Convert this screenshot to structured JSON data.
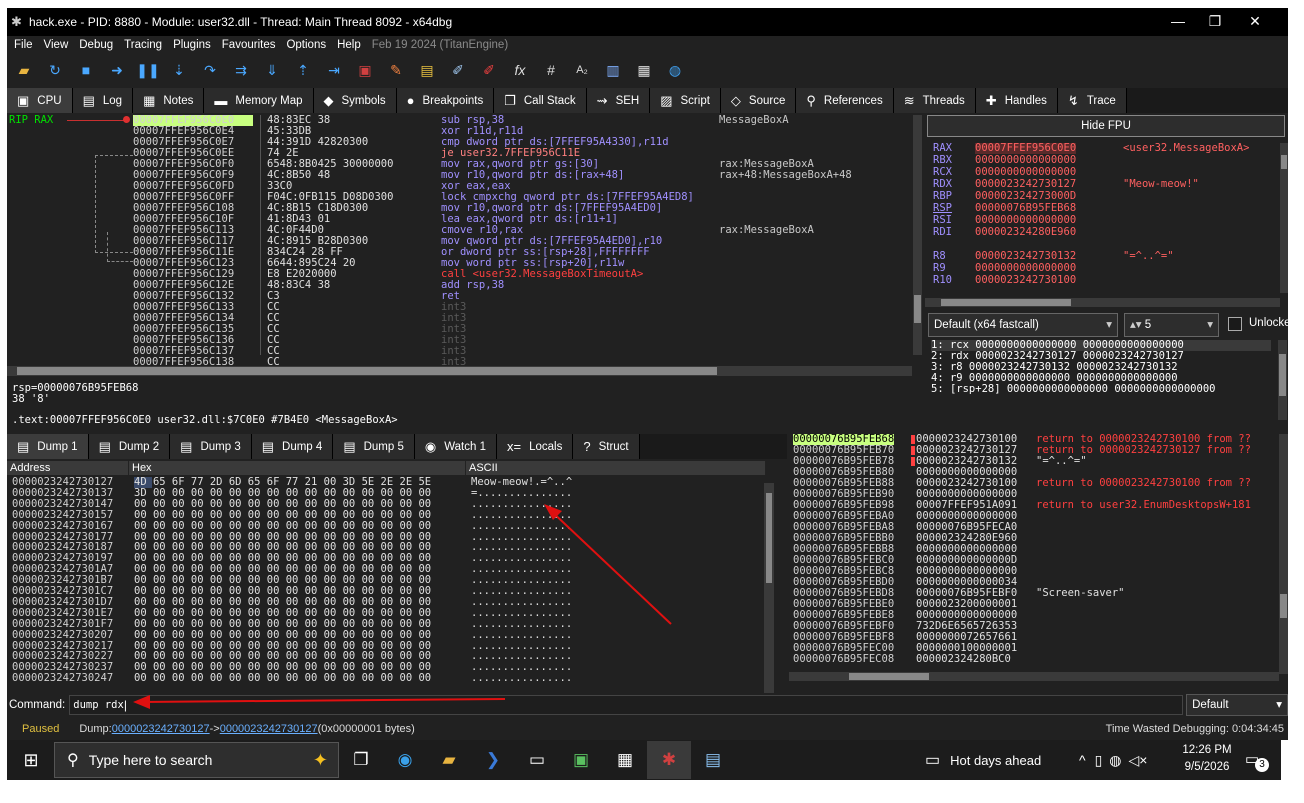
{
  "window": {
    "title": "hack.exe - PID: 8880 - Module: user32.dll - Thread: Main Thread 8092 - x64dbg",
    "minimize": "—",
    "maximize": "❐",
    "close": "✕"
  },
  "menu": {
    "items": [
      "File",
      "View",
      "Debug",
      "Tracing",
      "Plugins",
      "Favourites",
      "Options",
      "Help"
    ],
    "build": "Feb 19 2024 (TitanEngine)"
  },
  "tabs": [
    {
      "label": "CPU",
      "icon": "cpu-icon",
      "glyph": "▣"
    },
    {
      "label": "Log",
      "icon": "log-icon",
      "glyph": "▤"
    },
    {
      "label": "Notes",
      "icon": "notes-icon",
      "glyph": "▦"
    },
    {
      "label": "Memory Map",
      "icon": "memory-map-icon",
      "glyph": "▬"
    },
    {
      "label": "Symbols",
      "icon": "symbols-icon",
      "glyph": "◆"
    },
    {
      "label": "Breakpoints",
      "icon": "breakpoints-icon",
      "glyph": "●"
    },
    {
      "label": "Call Stack",
      "icon": "call-stack-icon",
      "glyph": "❐"
    },
    {
      "label": "SEH",
      "icon": "seh-icon",
      "glyph": "⇝"
    },
    {
      "label": "Script",
      "icon": "script-icon",
      "glyph": "▨"
    },
    {
      "label": "Source",
      "icon": "source-icon",
      "glyph": "◇"
    },
    {
      "label": "References",
      "icon": "references-icon",
      "glyph": "⚲"
    },
    {
      "label": "Threads",
      "icon": "threads-icon",
      "glyph": "≋"
    },
    {
      "label": "Handles",
      "icon": "handles-icon",
      "glyph": "✚"
    },
    {
      "label": "Trace",
      "icon": "trace-icon",
      "glyph": "↯"
    }
  ],
  "disasm": {
    "rip_label": "RIP RAX",
    "rows": [
      {
        "addr": "00007FFEF956C0E0",
        "bytes": "48:83EC 38",
        "asm": "sub rsp,38",
        "cmt": "MessageBoxA"
      },
      {
        "addr": "00007FFEF956C0E4",
        "bytes": "45:33DB",
        "asm": "xor r11d,r11d",
        "cmt": ""
      },
      {
        "addr": "00007FFEF956C0E7",
        "bytes": "44:391D 42820300",
        "asm": "cmp dword ptr ds:[7FFEF95A4330],r11d",
        "cmt": ""
      },
      {
        "addr": "00007FFEF956C0EE",
        "bytes": "74 2E",
        "asm": "je user32.7FFEF956C11E",
        "cmt": ""
      },
      {
        "addr": "00007FFEF956C0F0",
        "bytes": "6548:8B0425 30000000",
        "asm": "mov rax,qword ptr gs:[30]",
        "cmt": "rax:MessageBoxA"
      },
      {
        "addr": "00007FFEF956C0F9",
        "bytes": "4C:8B50 48",
        "asm": "mov r10,qword ptr ds:[rax+48]",
        "cmt": "rax+48:MessageBoxA+48"
      },
      {
        "addr": "00007FFEF956C0FD",
        "bytes": "33C0",
        "asm": "xor eax,eax",
        "cmt": ""
      },
      {
        "addr": "00007FFEF956C0FF",
        "bytes": "F04C:0FB115 D08D0300",
        "asm": "lock cmpxchg qword ptr ds:[7FFEF95A4ED8]",
        "cmt": ""
      },
      {
        "addr": "00007FFEF956C108",
        "bytes": "4C:8B15 C18D0300",
        "asm": "mov r10,qword ptr ds:[7FFEF95A4ED0]",
        "cmt": ""
      },
      {
        "addr": "00007FFEF956C10F",
        "bytes": "41:8D43 01",
        "asm": "lea eax,qword ptr ds:[r11+1]",
        "cmt": ""
      },
      {
        "addr": "00007FFEF956C113",
        "bytes": "4C:0F44D0",
        "asm": "cmove r10,rax",
        "cmt": "rax:MessageBoxA"
      },
      {
        "addr": "00007FFEF956C117",
        "bytes": "4C:8915 B28D0300",
        "asm": "mov qword ptr ds:[7FFEF95A4ED0],r10",
        "cmt": ""
      },
      {
        "addr": "00007FFEF956C11E",
        "bytes": "834C24 28 FF",
        "asm": "or dword ptr ss:[rsp+28],FFFFFFFF",
        "cmt": ""
      },
      {
        "addr": "00007FFEF956C123",
        "bytes": "6644:895C24 20",
        "asm": "mov word ptr ss:[rsp+20],r11w",
        "cmt": ""
      },
      {
        "addr": "00007FFEF956C129",
        "bytes": "E8 E2020000",
        "asm": "call <user32.MessageBoxTimeoutA>",
        "cmt": ""
      },
      {
        "addr": "00007FFEF956C12E",
        "bytes": "48:83C4 38",
        "asm": "add rsp,38",
        "cmt": ""
      },
      {
        "addr": "00007FFEF956C132",
        "bytes": "C3",
        "asm": "ret",
        "cmt": ""
      },
      {
        "addr": "00007FFEF956C133",
        "bytes": "CC",
        "asm": "int3",
        "cmt": ""
      },
      {
        "addr": "00007FFEF956C134",
        "bytes": "CC",
        "asm": "int3",
        "cmt": ""
      },
      {
        "addr": "00007FFEF956C135",
        "bytes": "CC",
        "asm": "int3",
        "cmt": ""
      },
      {
        "addr": "00007FFEF956C136",
        "bytes": "CC",
        "asm": "int3",
        "cmt": ""
      },
      {
        "addr": "00007FFEF956C137",
        "bytes": "CC",
        "asm": "int3",
        "cmt": ""
      },
      {
        "addr": "00007FFEF956C138",
        "bytes": "CC",
        "asm": "int3",
        "cmt": ""
      }
    ]
  },
  "info": {
    "line1": "rsp=00000076B95FEB68",
    "line2": "38 '8'",
    "line3": ".text:00007FFEF956C0E0 user32.dll:$7C0E0 #7B4E0 <MessageBoxA>"
  },
  "registers": {
    "hide_fpu": "Hide FPU",
    "rows": [
      {
        "name": "RAX",
        "value": "00007FFEF956C0E0",
        "cmt": "<user32.MessageBoxA>"
      },
      {
        "name": "RBX",
        "value": "0000000000000000",
        "cmt": ""
      },
      {
        "name": "RCX",
        "value": "0000000000000000",
        "cmt": ""
      },
      {
        "name": "RDX",
        "value": "0000023242730127",
        "cmt": "\"Meow-meow!\""
      },
      {
        "name": "RBP",
        "value": "000002324273000D",
        "cmt": ""
      },
      {
        "name": "RSP",
        "value": "00000076B95FEB68",
        "cmt": ""
      },
      {
        "name": "RSI",
        "value": "0000000000000000",
        "cmt": ""
      },
      {
        "name": "RDI",
        "value": "000002324280E960",
        "cmt": ""
      },
      {
        "name": "",
        "value": "",
        "cmt": ""
      },
      {
        "name": "R8",
        "value": "0000023242730132",
        "cmt": "\"=^..^=\""
      },
      {
        "name": "R9",
        "value": "0000000000000000",
        "cmt": ""
      },
      {
        "name": "R10",
        "value": "0000023242730100",
        "cmt": ""
      }
    ]
  },
  "callconv": {
    "selected": "Default (x64 fastcall)",
    "count": "5",
    "unlocked": "Unlocked"
  },
  "args": [
    "1: rcx 0000000000000000 0000000000000000",
    "2: rdx 0000023242730127 0000023242730127",
    "3: r8 0000023242730132 0000023242730132",
    "4: r9 0000000000000000 0000000000000000",
    "5: [rsp+28] 0000000000000000 0000000000000000"
  ],
  "dump_tabs": [
    {
      "label": "Dump 1",
      "icon": "dump-icon",
      "glyph": "▤"
    },
    {
      "label": "Dump 2",
      "icon": "dump-icon",
      "glyph": "▤"
    },
    {
      "label": "Dump 3",
      "icon": "dump-icon",
      "glyph": "▤"
    },
    {
      "label": "Dump 4",
      "icon": "dump-icon",
      "glyph": "▤"
    },
    {
      "label": "Dump 5",
      "icon": "dump-icon",
      "glyph": "▤"
    },
    {
      "label": "Watch 1",
      "icon": "watch-icon",
      "glyph": "◉"
    },
    {
      "label": "Locals",
      "icon": "locals-icon",
      "glyph": "x="
    },
    {
      "label": "Struct",
      "icon": "struct-icon",
      "glyph": "?"
    }
  ],
  "dump": {
    "headers": {
      "address": "Address",
      "hex": "Hex",
      "ascii": "ASCII"
    },
    "rows": [
      {
        "addr": "0000023242730127",
        "hex": "4D 65 6F 77 2D 6D 65 6F 77 21 00 3D 5E 2E 2E 5E",
        "ascii": "Meow-meow!.=^..^"
      },
      {
        "addr": "0000023242730137",
        "hex": "3D 00 00 00 00 00 00 00 00 00 00 00 00 00 00 00",
        "ascii": "=..............."
      },
      {
        "addr": "0000023242730147",
        "hex": "00 00 00 00 00 00 00 00 00 00 00 00 00 00 00 00",
        "ascii": "................"
      },
      {
        "addr": "0000023242730157",
        "hex": "00 00 00 00 00 00 00 00 00 00 00 00 00 00 00 00",
        "ascii": "................"
      },
      {
        "addr": "0000023242730167",
        "hex": "00 00 00 00 00 00 00 00 00 00 00 00 00 00 00 00",
        "ascii": "................"
      },
      {
        "addr": "0000023242730177",
        "hex": "00 00 00 00 00 00 00 00 00 00 00 00 00 00 00 00",
        "ascii": "................"
      },
      {
        "addr": "0000023242730187",
        "hex": "00 00 00 00 00 00 00 00 00 00 00 00 00 00 00 00",
        "ascii": "................"
      },
      {
        "addr": "0000023242730197",
        "hex": "00 00 00 00 00 00 00 00 00 00 00 00 00 00 00 00",
        "ascii": "................"
      },
      {
        "addr": "00000232427301A7",
        "hex": "00 00 00 00 00 00 00 00 00 00 00 00 00 00 00 00",
        "ascii": "................"
      },
      {
        "addr": "00000232427301B7",
        "hex": "00 00 00 00 00 00 00 00 00 00 00 00 00 00 00 00",
        "ascii": "................"
      },
      {
        "addr": "00000232427301C7",
        "hex": "00 00 00 00 00 00 00 00 00 00 00 00 00 00 00 00",
        "ascii": "................"
      },
      {
        "addr": "00000232427301D7",
        "hex": "00 00 00 00 00 00 00 00 00 00 00 00 00 00 00 00",
        "ascii": "................"
      },
      {
        "addr": "00000232427301E7",
        "hex": "00 00 00 00 00 00 00 00 00 00 00 00 00 00 00 00",
        "ascii": "................"
      },
      {
        "addr": "00000232427301F7",
        "hex": "00 00 00 00 00 00 00 00 00 00 00 00 00 00 00 00",
        "ascii": "................"
      },
      {
        "addr": "0000023242730207",
        "hex": "00 00 00 00 00 00 00 00 00 00 00 00 00 00 00 00",
        "ascii": "................"
      },
      {
        "addr": "0000023242730217",
        "hex": "00 00 00 00 00 00 00 00 00 00 00 00 00 00 00 00",
        "ascii": "................"
      },
      {
        "addr": "0000023242730227",
        "hex": "00 00 00 00 00 00 00 00 00 00 00 00 00 00 00 00",
        "ascii": "................"
      },
      {
        "addr": "0000023242730237",
        "hex": "00 00 00 00 00 00 00 00 00 00 00 00 00 00 00 00",
        "ascii": "................"
      },
      {
        "addr": "0000023242730247",
        "hex": "00 00 00 00 00 00 00 00 00 00 00 00 00 00 00 00",
        "ascii": "................"
      }
    ]
  },
  "stack": {
    "rows": [
      {
        "addr": "00000076B95FEB68",
        "value": "0000023242730100",
        "cmt": "return to 0000023242730100 from ??",
        "kind": "ret"
      },
      {
        "addr": "00000076B95FEB70",
        "value": "0000023242730127",
        "cmt": "return to 0000023242730127 from ??",
        "kind": "ret"
      },
      {
        "addr": "00000076B95FEB78",
        "value": "0000023242730132",
        "cmt": "\"=^..^=\"",
        "kind": "str"
      },
      {
        "addr": "00000076B95FEB80",
        "value": "0000000000000000",
        "cmt": "",
        "kind": ""
      },
      {
        "addr": "00000076B95FEB88",
        "value": "0000023242730100",
        "cmt": "return to 0000023242730100 from ??",
        "kind": "ret"
      },
      {
        "addr": "00000076B95FEB90",
        "value": "0000000000000000",
        "cmt": "",
        "kind": ""
      },
      {
        "addr": "00000076B95FEB98",
        "value": "00007FFEF951A091",
        "cmt": "return to user32.EnumDesktopsW+181",
        "kind": "ret"
      },
      {
        "addr": "00000076B95FEBA0",
        "value": "0000000000000000",
        "cmt": "",
        "kind": ""
      },
      {
        "addr": "00000076B95FEBA8",
        "value": "00000076B95FECA0",
        "cmt": "",
        "kind": ""
      },
      {
        "addr": "00000076B95FEBB0",
        "value": "000002324280E960",
        "cmt": "",
        "kind": ""
      },
      {
        "addr": "00000076B95FEBB8",
        "value": "0000000000000000",
        "cmt": "",
        "kind": ""
      },
      {
        "addr": "00000076B95FEBC0",
        "value": "000000000000000D",
        "cmt": "",
        "kind": ""
      },
      {
        "addr": "00000076B95FEBC8",
        "value": "0000000000000000",
        "cmt": "",
        "kind": ""
      },
      {
        "addr": "00000076B95FEBD0",
        "value": "0000000000000034",
        "cmt": "",
        "kind": ""
      },
      {
        "addr": "00000076B95FEBD8",
        "value": "00000076B95FEBF0",
        "cmt": "\"Screen-saver\"",
        "kind": "str"
      },
      {
        "addr": "00000076B95FEBE0",
        "value": "0000023200000001",
        "cmt": "",
        "kind": ""
      },
      {
        "addr": "00000076B95FEBE8",
        "value": "0000000000000000",
        "cmt": "",
        "kind": ""
      },
      {
        "addr": "00000076B95FEBF0",
        "value": "732D6E6565726353",
        "cmt": "",
        "kind": ""
      },
      {
        "addr": "00000076B95FEBF8",
        "value": "0000000072657661",
        "cmt": "",
        "kind": ""
      },
      {
        "addr": "00000076B95FEC00",
        "value": "0000000100000001",
        "cmt": "",
        "kind": ""
      },
      {
        "addr": "00000076B95FEC08",
        "value": "000002324280BC0",
        "cmt": "",
        "kind": ""
      }
    ]
  },
  "command": {
    "label": "Command:",
    "value": "dump rdx",
    "mode": "Default"
  },
  "status": {
    "state": "Paused",
    "dump_prefix": "Dump: ",
    "from": "0000023242730127",
    "arrow": " -> ",
    "to": "0000023242730127",
    "size": " (0x00000001 bytes)",
    "wasted": "Time Wasted Debugging: 0:04:34:45"
  },
  "taskbar": {
    "search_placeholder": "Type here to search",
    "weather": "Hot days ahead",
    "time": "12:26 PM",
    "date": "9/5/2026",
    "notifications": "3"
  },
  "colors": {
    "background": "#212121",
    "highlight": "#c8ff80",
    "register_changed": "#ff5050",
    "asm": "#a090ff",
    "annotation": "#e01010"
  }
}
